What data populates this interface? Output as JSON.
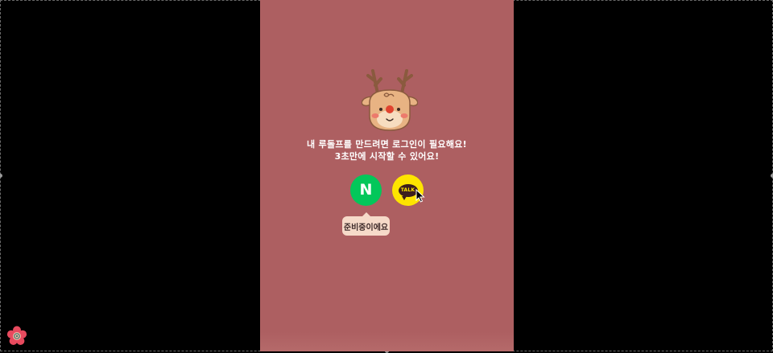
{
  "screen": {
    "background_color": "#000000",
    "panel_color": "#ad5f61",
    "mascot": "reindeer-mascot-icon"
  },
  "login": {
    "message_line1": "내 루돌프를 만드려면 로그인이 필요해요!",
    "message_line2": "3초만에 시작할 수 있어요!",
    "naver_label": "N",
    "naver_color": "#03c75a",
    "kakao_label": "TALK",
    "kakao_color": "#fee500",
    "tooltip": "준비중이에요"
  },
  "corner_icon": "flower-logo-icon"
}
